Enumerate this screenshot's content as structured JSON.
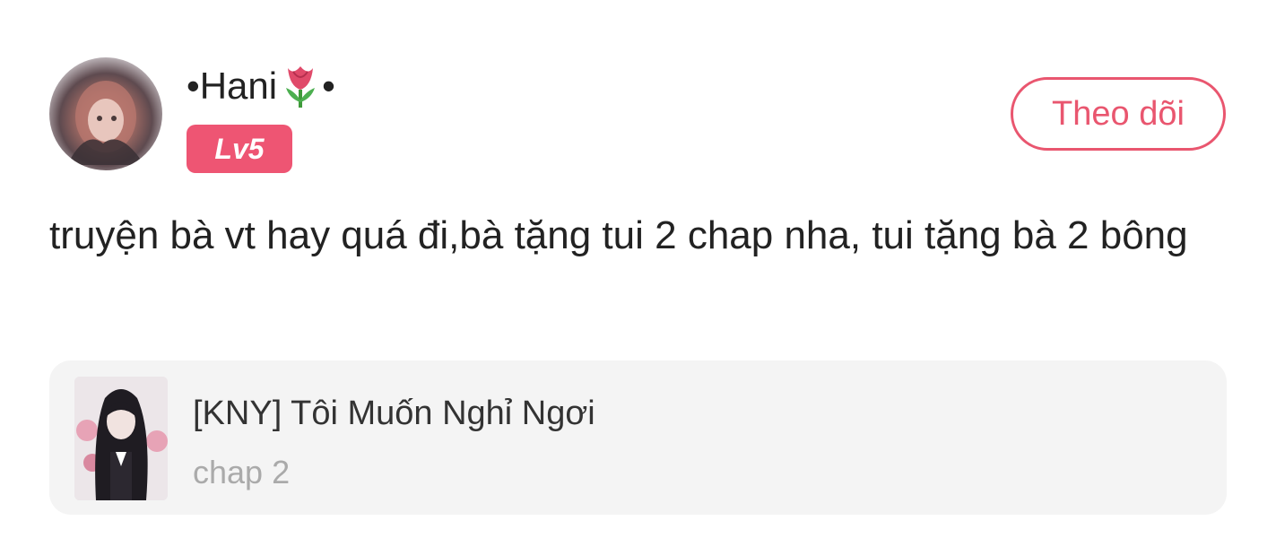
{
  "user": {
    "name_prefix": "•Hani",
    "name_suffix": "•",
    "name_emoji_icon": "tulip-icon",
    "level": "Lv5",
    "avatar_icon": "anime-girl-avatar"
  },
  "actions": {
    "follow_label": "Theo dõi"
  },
  "comment": {
    "text": "truyện bà vt hay quá đi,bà tặng tui 2 chap nha, tui tặng bà 2 bông"
  },
  "story": {
    "title": "[KNY] Tôi Muốn Nghỉ Ngơi",
    "chapter": "chap 2",
    "cover_icon": "story-cover-image"
  },
  "colors": {
    "accent": "#e9566f",
    "badge": "#ee5573",
    "card_background": "#f4f4f4",
    "secondary_text": "#aaaaaa"
  }
}
